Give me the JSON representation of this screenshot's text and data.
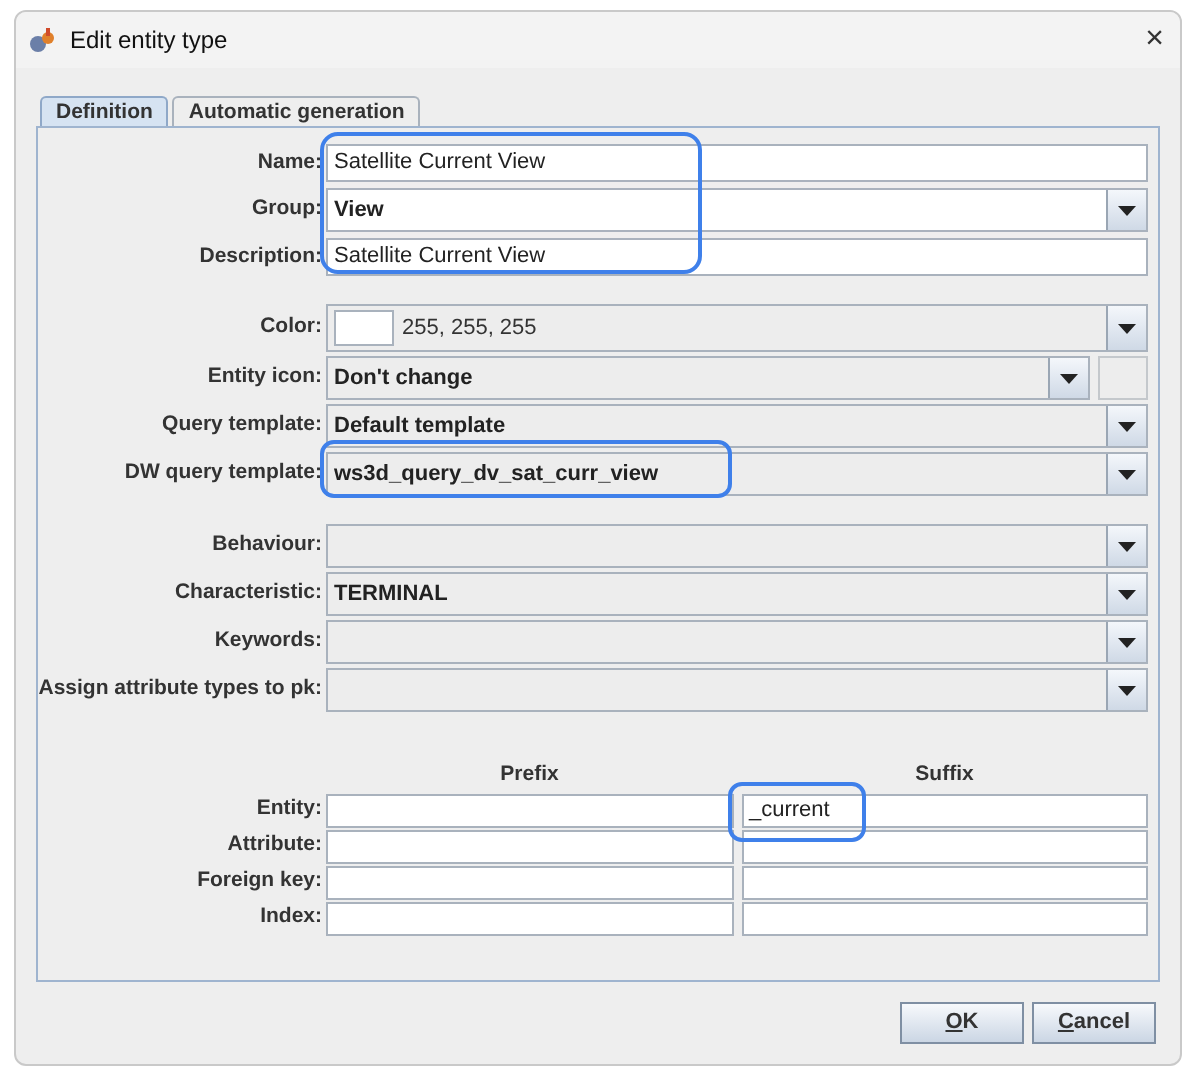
{
  "window": {
    "title": "Edit entity type",
    "close": "×"
  },
  "tabs": [
    {
      "label": "Definition",
      "selected": true
    },
    {
      "label": "Automatic generation",
      "selected": false
    }
  ],
  "sections": [
    {
      "rows": [
        {
          "kind": "text",
          "label": "Name:",
          "value": "Satellite Current View"
        },
        {
          "kind": "combo_edit",
          "label": "Group:",
          "value": "View"
        },
        {
          "kind": "text",
          "label": "Description:",
          "value": "Satellite Current View"
        }
      ]
    },
    {
      "rows": [
        {
          "kind": "color",
          "label": "Color:",
          "color": "#ffffff",
          "value": "255, 255, 255"
        },
        {
          "kind": "icon_combo",
          "label": "Entity icon:",
          "value": "Don't change"
        },
        {
          "kind": "combo",
          "label": "Query template:",
          "value": "Default template"
        },
        {
          "kind": "combo",
          "label": "DW query template:",
          "value": "ws3d_query_dv_sat_curr_view"
        }
      ]
    },
    {
      "rows": [
        {
          "kind": "combo",
          "label": "Behaviour:"
        },
        {
          "kind": "combo",
          "label": "Characteristic:",
          "value": "TERMINAL"
        },
        {
          "kind": "combo_edit",
          "label": "Keywords:"
        },
        {
          "kind": "combo_edit",
          "label": "Assign attribute types to pk:"
        }
      ]
    }
  ],
  "affixes": {
    "columns": [
      "Prefix",
      "Suffix"
    ],
    "rows": [
      {
        "label": "Entity:",
        "suffix": "_current"
      },
      {
        "label": "Attribute:"
      },
      {
        "label": "Foreign key:"
      },
      {
        "label": "Index:"
      }
    ]
  },
  "buttons": [
    {
      "label": "OK"
    },
    {
      "label": "Cancel"
    }
  ]
}
